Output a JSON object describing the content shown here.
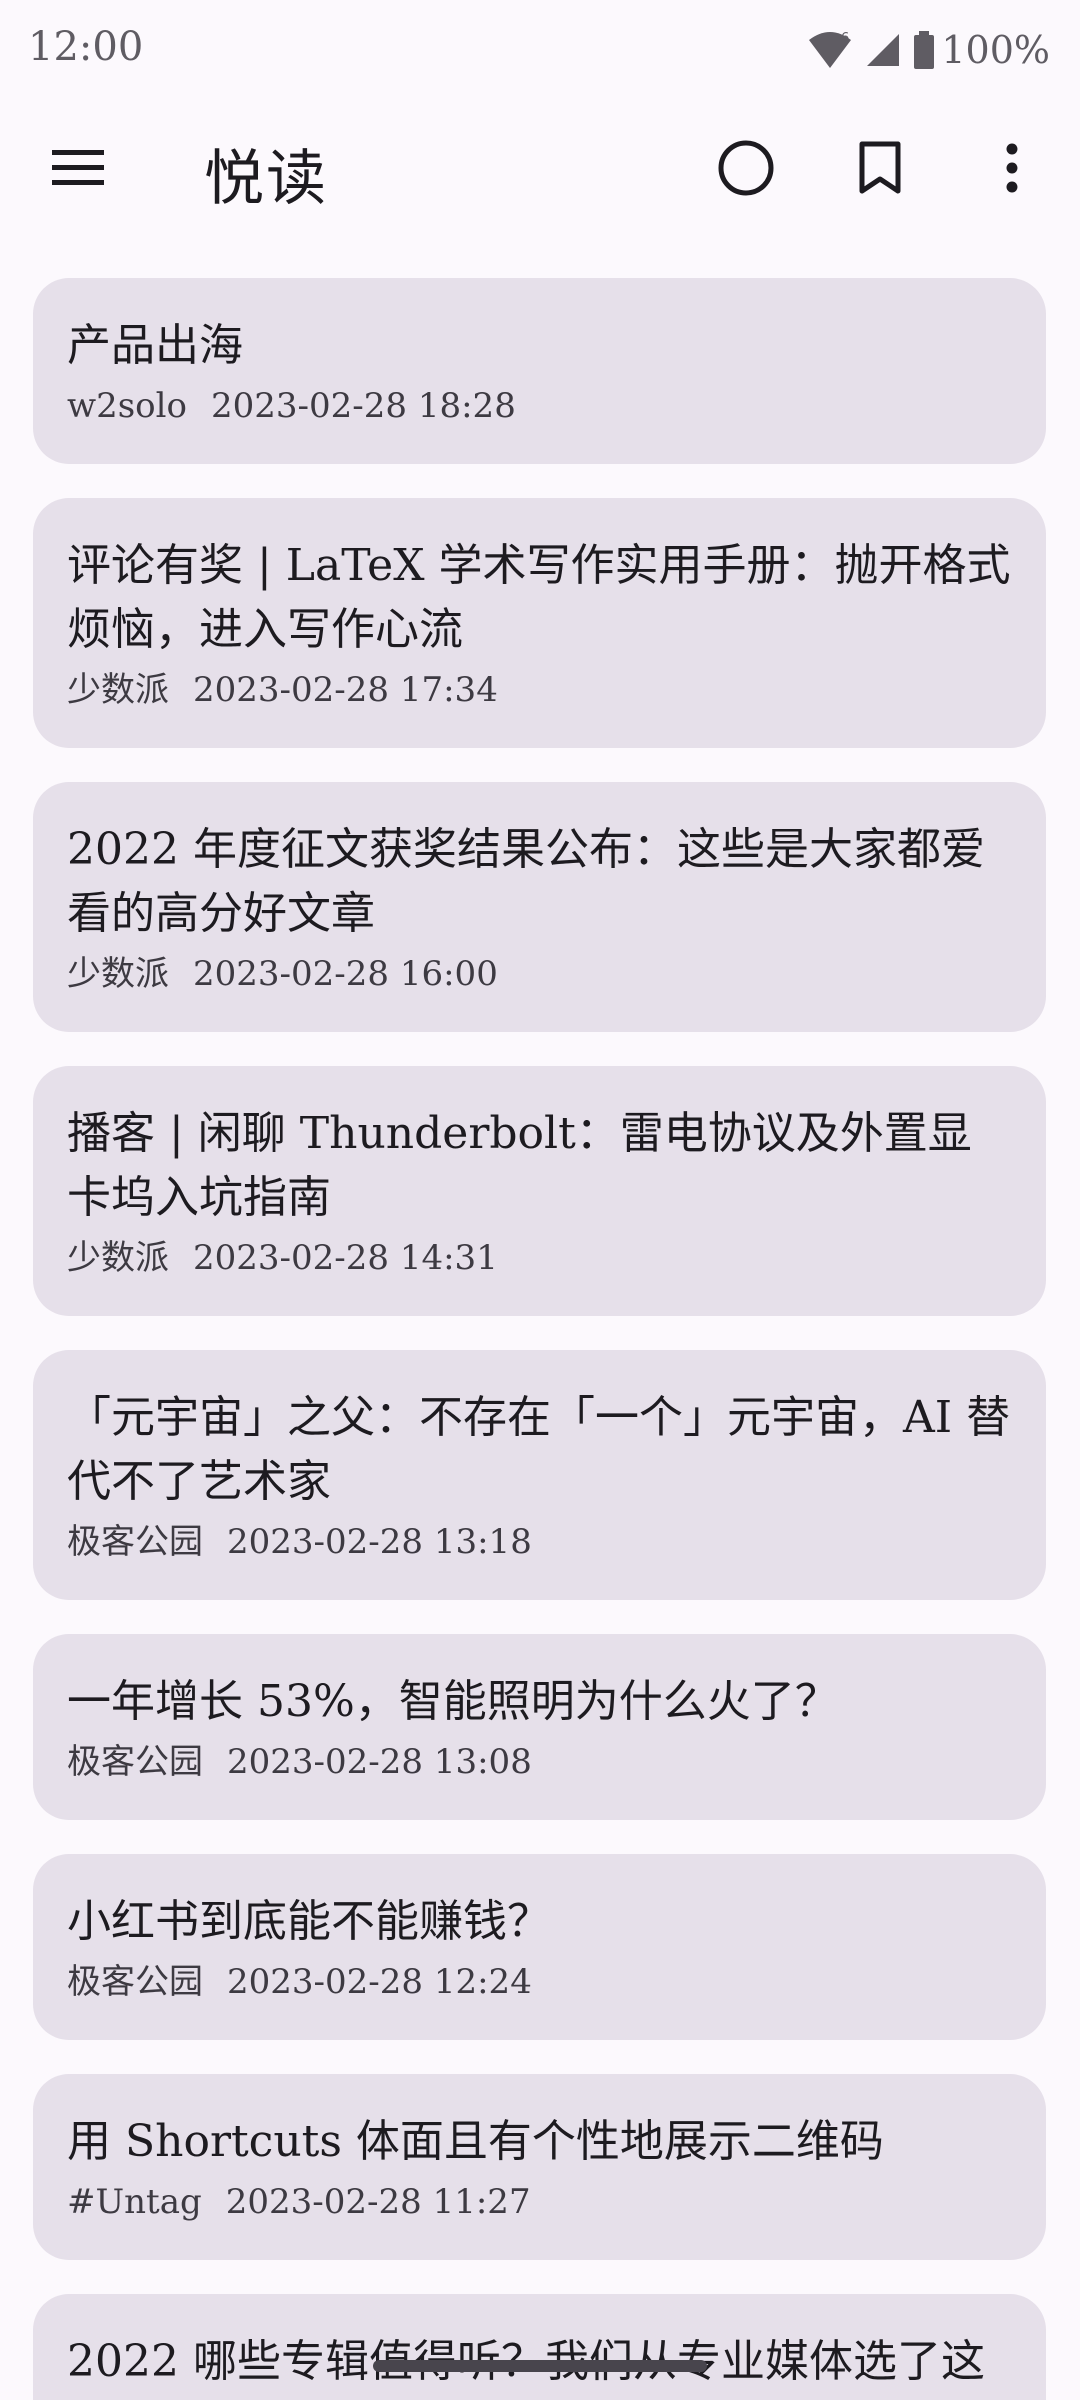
{
  "status": {
    "time": "12:00",
    "wifi_badge": "6",
    "battery": "100%"
  },
  "app_bar": {
    "title": "悦读",
    "icons": [
      "menu-icon",
      "circle-icon",
      "bookmark-icon",
      "more-vert-icon"
    ]
  },
  "feed": [
    {
      "title": "产品出海",
      "source": "w2solo",
      "time": "2023-02-28 18:28"
    },
    {
      "title": "评论有奖 | LaTeX 学术写作实用手册：抛开格式烦恼，进入写作心流",
      "source": "少数派",
      "time": "2023-02-28 17:34"
    },
    {
      "title": "2022 年度征文获奖结果公布：这些是大家都爱看的高分好文章",
      "source": "少数派",
      "time": "2023-02-28 16:00"
    },
    {
      "title": "播客 | 闲聊 Thunderbolt：雷电协议及外置显卡坞入坑指南",
      "source": "少数派",
      "time": "2023-02-28 14:31"
    },
    {
      "title": "「元宇宙」之父：不存在「一个」元宇宙，AI 替代不了艺术家",
      "source": "极客公园",
      "time": "2023-02-28 13:18"
    },
    {
      "title": "一年增长 53%，智能照明为什么火了？",
      "source": "极客公园",
      "time": "2023-02-28 13:08"
    },
    {
      "title": "小红书到底能不能赚钱？",
      "source": "极客公园",
      "time": "2023-02-28 12:24"
    },
    {
      "title": "用 Shortcuts 体面且有个性地展示二维码",
      "source": "#Untag",
      "time": "2023-02-28 11:27"
    },
    {
      "title": "2022 哪些专辑值得听？我们从专业媒体选了这",
      "source": "",
      "time": ""
    }
  ],
  "colors": {
    "background": "#fcf9fd",
    "card": "#e6e0ea",
    "text": "#1d1b20"
  }
}
